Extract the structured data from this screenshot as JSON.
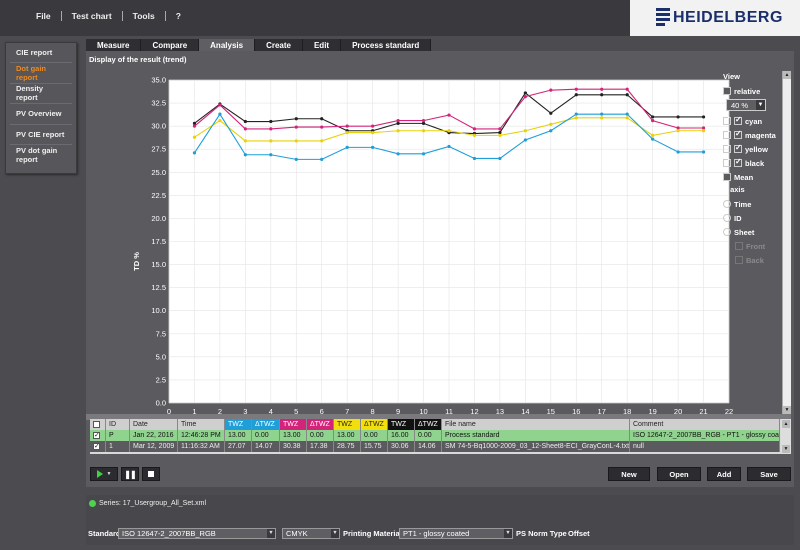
{
  "menu": [
    "File",
    "Test chart",
    "Tools",
    "?"
  ],
  "brand": {
    "name": "HEIDELBERG",
    "color": "#1b2f6b"
  },
  "sidebar": [
    {
      "label": "CIE report",
      "active": false
    },
    {
      "label": "Dot gain report",
      "active": true
    },
    {
      "label": "Density report",
      "active": false
    },
    {
      "label": "PV Overview",
      "active": false
    },
    {
      "label": "PV CIE report",
      "active": false
    },
    {
      "label": "PV dot gain report",
      "active": false
    }
  ],
  "tabs": [
    {
      "label": "Measure",
      "active": false
    },
    {
      "label": "Compare",
      "active": false
    },
    {
      "label": "Analysis",
      "active": true
    },
    {
      "label": "Create",
      "active": false
    },
    {
      "label": "Edit",
      "active": false
    },
    {
      "label": "Process standard",
      "active": false
    }
  ],
  "panel_title": "Display of the result (trend)",
  "view": {
    "header": "View",
    "relative_label": "relative",
    "relative_checked": false,
    "percent_value": "40 %",
    "series_options": [
      {
        "label": "cyan",
        "checked": true
      },
      {
        "label": "magenta",
        "checked": true
      },
      {
        "label": "yellow",
        "checked": true
      },
      {
        "label": "black",
        "checked": true
      }
    ],
    "mean_label": "Mean",
    "mean_checked": false,
    "xaxis_header": "X axis",
    "xaxis_options": [
      {
        "label": "Time",
        "selected": false
      },
      {
        "label": "ID",
        "selected": true
      },
      {
        "label": "Sheet",
        "selected": false
      }
    ],
    "front_label": "Front",
    "back_label": "Back"
  },
  "chart_data": {
    "type": "line",
    "ylabel": "TD %",
    "xlim": [
      0,
      22
    ],
    "ylim": [
      0,
      35
    ],
    "xticks": [
      0,
      1,
      2,
      3,
      4,
      5,
      6,
      7,
      8,
      9,
      10,
      11,
      12,
      13,
      14,
      15,
      16,
      17,
      18,
      19,
      20,
      21,
      22
    ],
    "yticks": [
      "0.0",
      "2.5",
      "5.0",
      "7.5",
      "10.0",
      "12.5",
      "15.0",
      "17.5",
      "20.0",
      "22.5",
      "25.0",
      "27.5",
      "30.0",
      "32.5",
      "35.0"
    ],
    "grid": true,
    "x": [
      1,
      2,
      3,
      4,
      5,
      6,
      7,
      8,
      9,
      10,
      11,
      12,
      13,
      14,
      15,
      16,
      17,
      18,
      19,
      20,
      21
    ],
    "series": [
      {
        "color": "#222222",
        "values": [
          30.3,
          32.4,
          30.5,
          30.5,
          30.8,
          30.8,
          29.5,
          29.5,
          30.3,
          30.3,
          29.3,
          29.2,
          29.3,
          33.6,
          31.4,
          33.4,
          33.4,
          33.4,
          31.0,
          31.0,
          31.0
        ]
      },
      {
        "color": "#d4237a",
        "values": [
          30.0,
          32.3,
          29.7,
          29.7,
          29.9,
          29.9,
          30.0,
          30.0,
          30.6,
          30.6,
          31.2,
          29.7,
          29.7,
          33.2,
          33.9,
          34.0,
          34.0,
          34.0,
          30.6,
          29.8,
          29.8
        ]
      },
      {
        "color": "#e8d20a",
        "values": [
          28.8,
          30.6,
          28.4,
          28.4,
          28.4,
          28.4,
          29.3,
          29.3,
          29.5,
          29.5,
          29.5,
          29.0,
          29.0,
          29.5,
          30.2,
          30.9,
          30.9,
          30.9,
          29.0,
          29.5,
          29.5
        ]
      },
      {
        "color": "#1f9ed8",
        "values": [
          27.1,
          31.3,
          26.9,
          26.9,
          26.4,
          26.4,
          27.7,
          27.7,
          27.0,
          27.0,
          27.8,
          26.5,
          26.5,
          28.5,
          29.5,
          31.3,
          31.3,
          31.3,
          28.6,
          27.2,
          27.2
        ]
      }
    ]
  },
  "table": {
    "headers": [
      "ID",
      "Date",
      "Time",
      "TWZ",
      "ΔTWZ",
      "TWZ",
      "ΔTWZ",
      "TWZ",
      "ΔTWZ",
      "TWZ",
      "ΔTWZ",
      "File name",
      "Comment"
    ],
    "rows": [
      {
        "checked": true,
        "cells": [
          "P",
          "Jan 22, 2016",
          "12:46:28 PM",
          "13.00",
          "0.00",
          "13.00",
          "0.00",
          "13.00",
          "0.00",
          "16.00",
          "0.00",
          "Process standard",
          "ISO 12647-2_2007BB_RGB - PT1 - glossy coa"
        ]
      },
      {
        "checked": true,
        "cells": [
          "1",
          "Mar 12, 2009",
          "11:16:32 AM",
          "27.07",
          "14.07",
          "30.38",
          "17.38",
          "28.75",
          "15.75",
          "30.06",
          "14.06",
          "SM 74-5-Bq1000-2009_03_12-Sheet8-ECI_GrayConL-4.txt",
          "null"
        ]
      }
    ]
  },
  "buttons": {
    "new": "New",
    "open": "Open",
    "add": "Add",
    "save": "Save"
  },
  "series_file": "Series: 17_Usergroup_All_Set.xml",
  "standard_label": "Standard",
  "standard_value": "ISO 12647-2_2007BB_RGB",
  "colorspace_value": "CMYK",
  "printing_material_label": "Printing Material",
  "printing_material_value": "PT1 - glossy coated",
  "ps_norm_label": "PS Norm Type",
  "ps_norm_value": "Offset"
}
